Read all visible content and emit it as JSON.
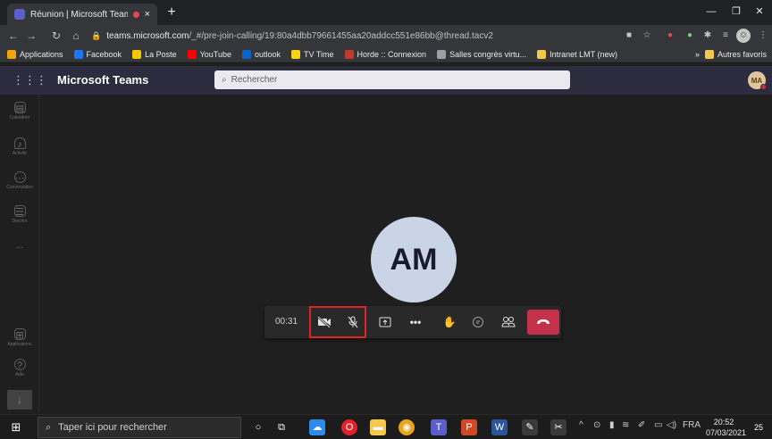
{
  "browser": {
    "tab_title": "Réunion | Microsoft Teams",
    "tab_close": "×",
    "new_tab": "+",
    "url_host": "teams.microsoft.com",
    "url_path": "/_#/pre-join-calling/19:80a4dbb79661455aa20addcc551e86bb@thread.tacv2",
    "bookmarks": [
      "Applications",
      "Facebook",
      "La Poste",
      "YouTube",
      "outlook",
      "TV Time",
      "Horde :: Connexion",
      "Salles congrès virtu...",
      "Intranet LMT (new)"
    ],
    "bookmarks_overflow": "»",
    "other_bookmarks": "Autres favoris"
  },
  "teams": {
    "app_title": "Microsoft Teams",
    "search_placeholder": "Rechercher",
    "user_initials": "MA",
    "rail": [
      {
        "label": "Calendrier",
        "icon": "calendar-icon"
      },
      {
        "label": "Activité",
        "icon": "bell-icon"
      },
      {
        "label": "Conversation",
        "icon": "chat-icon"
      },
      {
        "label": "Devoirs",
        "icon": "assignments-icon"
      },
      {
        "label": "...",
        "icon": "more-icon"
      },
      {
        "label": "Applications",
        "icon": "apps-icon"
      },
      {
        "label": "Aide",
        "icon": "help-icon"
      }
    ]
  },
  "call": {
    "participant_initials": "AM",
    "timer": "00:31",
    "controls": [
      "camera-off-icon",
      "mic-off-icon",
      "share-screen-icon",
      "more-actions-icon",
      "raise-hand-icon",
      "chat-icon",
      "participants-icon",
      "hang-up-icon"
    ],
    "hangup_color": "#c4314b",
    "highlight_color": "#e02424"
  },
  "taskbar": {
    "search_placeholder": "Taper ici pour rechercher",
    "language": "FRA",
    "time": "20:52",
    "date": "07/03/2021",
    "notification_count": "25"
  }
}
